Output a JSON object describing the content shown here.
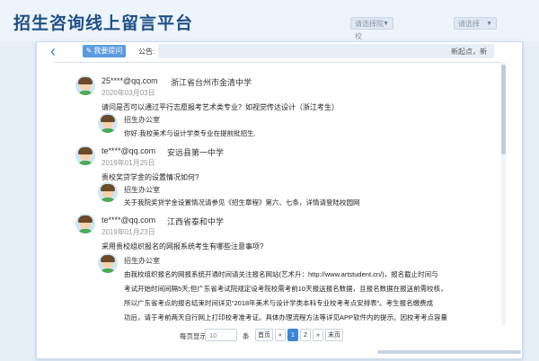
{
  "header": {
    "title": "招生咨询线上留言平台",
    "select1": "请选择院校",
    "select2": "请选择"
  },
  "toolbar": {
    "ask_button": "我要提问",
    "notice_label": "公告:",
    "notice_text": "新起点，新"
  },
  "posts": [
    {
      "email": "25****@qq.com",
      "school": "浙江省台州市金清中学",
      "date": "2020年03月03日",
      "question": "请问是否可以通过平行志愿报考艺术类专业？如视觉传达设计（浙江考生）",
      "reply_name": "招生办公室",
      "reply_lines": [
        "你好,我校美术与设计学类专业在提前批招生."
      ]
    },
    {
      "email": "te****@qq.com",
      "school": "安远县第一中学",
      "date": "2019年01月25日",
      "question": "贵校奖贷学金的设置情况如何?",
      "reply_name": "招生办公室",
      "reply_lines": [
        "关于我院奖贷学金设置情况请参见《招生章程》第六、七条，详情请登陆校园网"
      ]
    },
    {
      "email": "te****@qq.com",
      "school": "江西省泰和中学",
      "date": "2019年01月23日",
      "question": "采用贵校组织报名的网报系统考生有哪些注意事项?",
      "reply_name": "招生办公室",
      "reply_lines": [
        "由我校组织报名的网报系统开通时间请关注报名网站(艺术升：http://www.artstudent.cn/)，报名截止时间与",
        "考试开始时间间隔5天;但广东省考试院规定设考院校需考前10天报送报名数据，且报名数据在报送前需校核，",
        "所以广东省考点的报名结束时间详见“2018年美术与设计学类本科专业校考考点安排表”。考生报名缴费成",
        "功后，请于考前两天自行网上打印校考准考证。具体办理流程方法等详见APP软件内的提示。因校考考点容量"
      ]
    }
  ],
  "pagination": {
    "per_page_label": "每页显示",
    "per_page_value": "10",
    "unit_label": "条",
    "first": "首页",
    "prev": "«",
    "pages": [
      "1",
      "2"
    ],
    "next": "»",
    "last": "末页"
  }
}
